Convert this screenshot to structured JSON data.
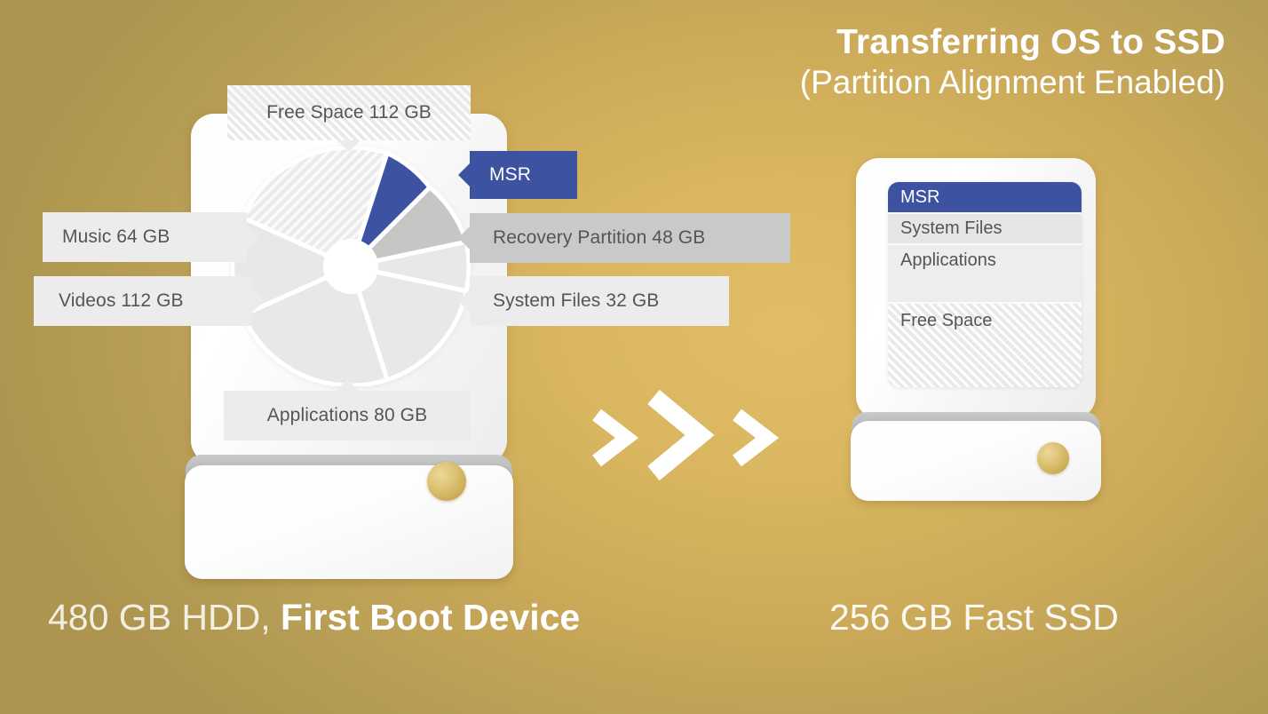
{
  "title": {
    "line1": "Transferring OS to SSD",
    "line2": "(Partition Alignment Enabled)"
  },
  "colors": {
    "background_gold_bright": "#dfbc65",
    "background_gold_dark": "#ad954f",
    "accent_blue": "#3d52a0",
    "label_light_gray": "#ececec",
    "label_mid_gray": "#c9c9c9",
    "label_text": "#555555",
    "drive_white": "#ffffff",
    "led_gold": "#ddc274"
  },
  "source_drive": {
    "caption_prefix": "480 GB HDD, ",
    "caption_emphasis": "First Boot Device",
    "capacity_gb": 480,
    "labels": {
      "free_space": "Free Space 112 GB",
      "music": "Music 64 GB",
      "videos": "Videos 112 GB",
      "msr": "MSR",
      "recovery": "Recovery Partition 48 GB",
      "system_files": "System Files 32 GB",
      "applications": "Applications 80 GB"
    }
  },
  "target_drive": {
    "caption": "256 GB Fast SSD",
    "capacity_gb": 256,
    "segments": [
      {
        "label": "MSR",
        "style": "blue"
      },
      {
        "label": "System Files",
        "style": "gray"
      },
      {
        "label": "Applications",
        "style": "gray-light"
      },
      {
        "label": "Free Space",
        "style": "hatched"
      }
    ]
  },
  "transfer_arrows": {
    "count": 3,
    "direction": "right",
    "glyph": "chevron-right"
  },
  "chart_data": {
    "type": "pie",
    "title": "480 GB HDD partition usage",
    "categories": [
      "Free Space",
      "MSR",
      "Recovery Partition",
      "System Files",
      "Applications",
      "Videos",
      "Music"
    ],
    "values": [
      112,
      32,
      48,
      32,
      80,
      112,
      64
    ],
    "unit": "GB",
    "total": 480,
    "colors": [
      "hatched-#e9e9e9",
      "#3d52a0",
      "#c9c9c9",
      "#e8e8e8",
      "#e8e8e8",
      "#e8e8e8",
      "#e8e8e8"
    ],
    "start_angle_deg": -60,
    "direction": "clockwise",
    "donut_hole": true,
    "legend": "callout-labels"
  }
}
